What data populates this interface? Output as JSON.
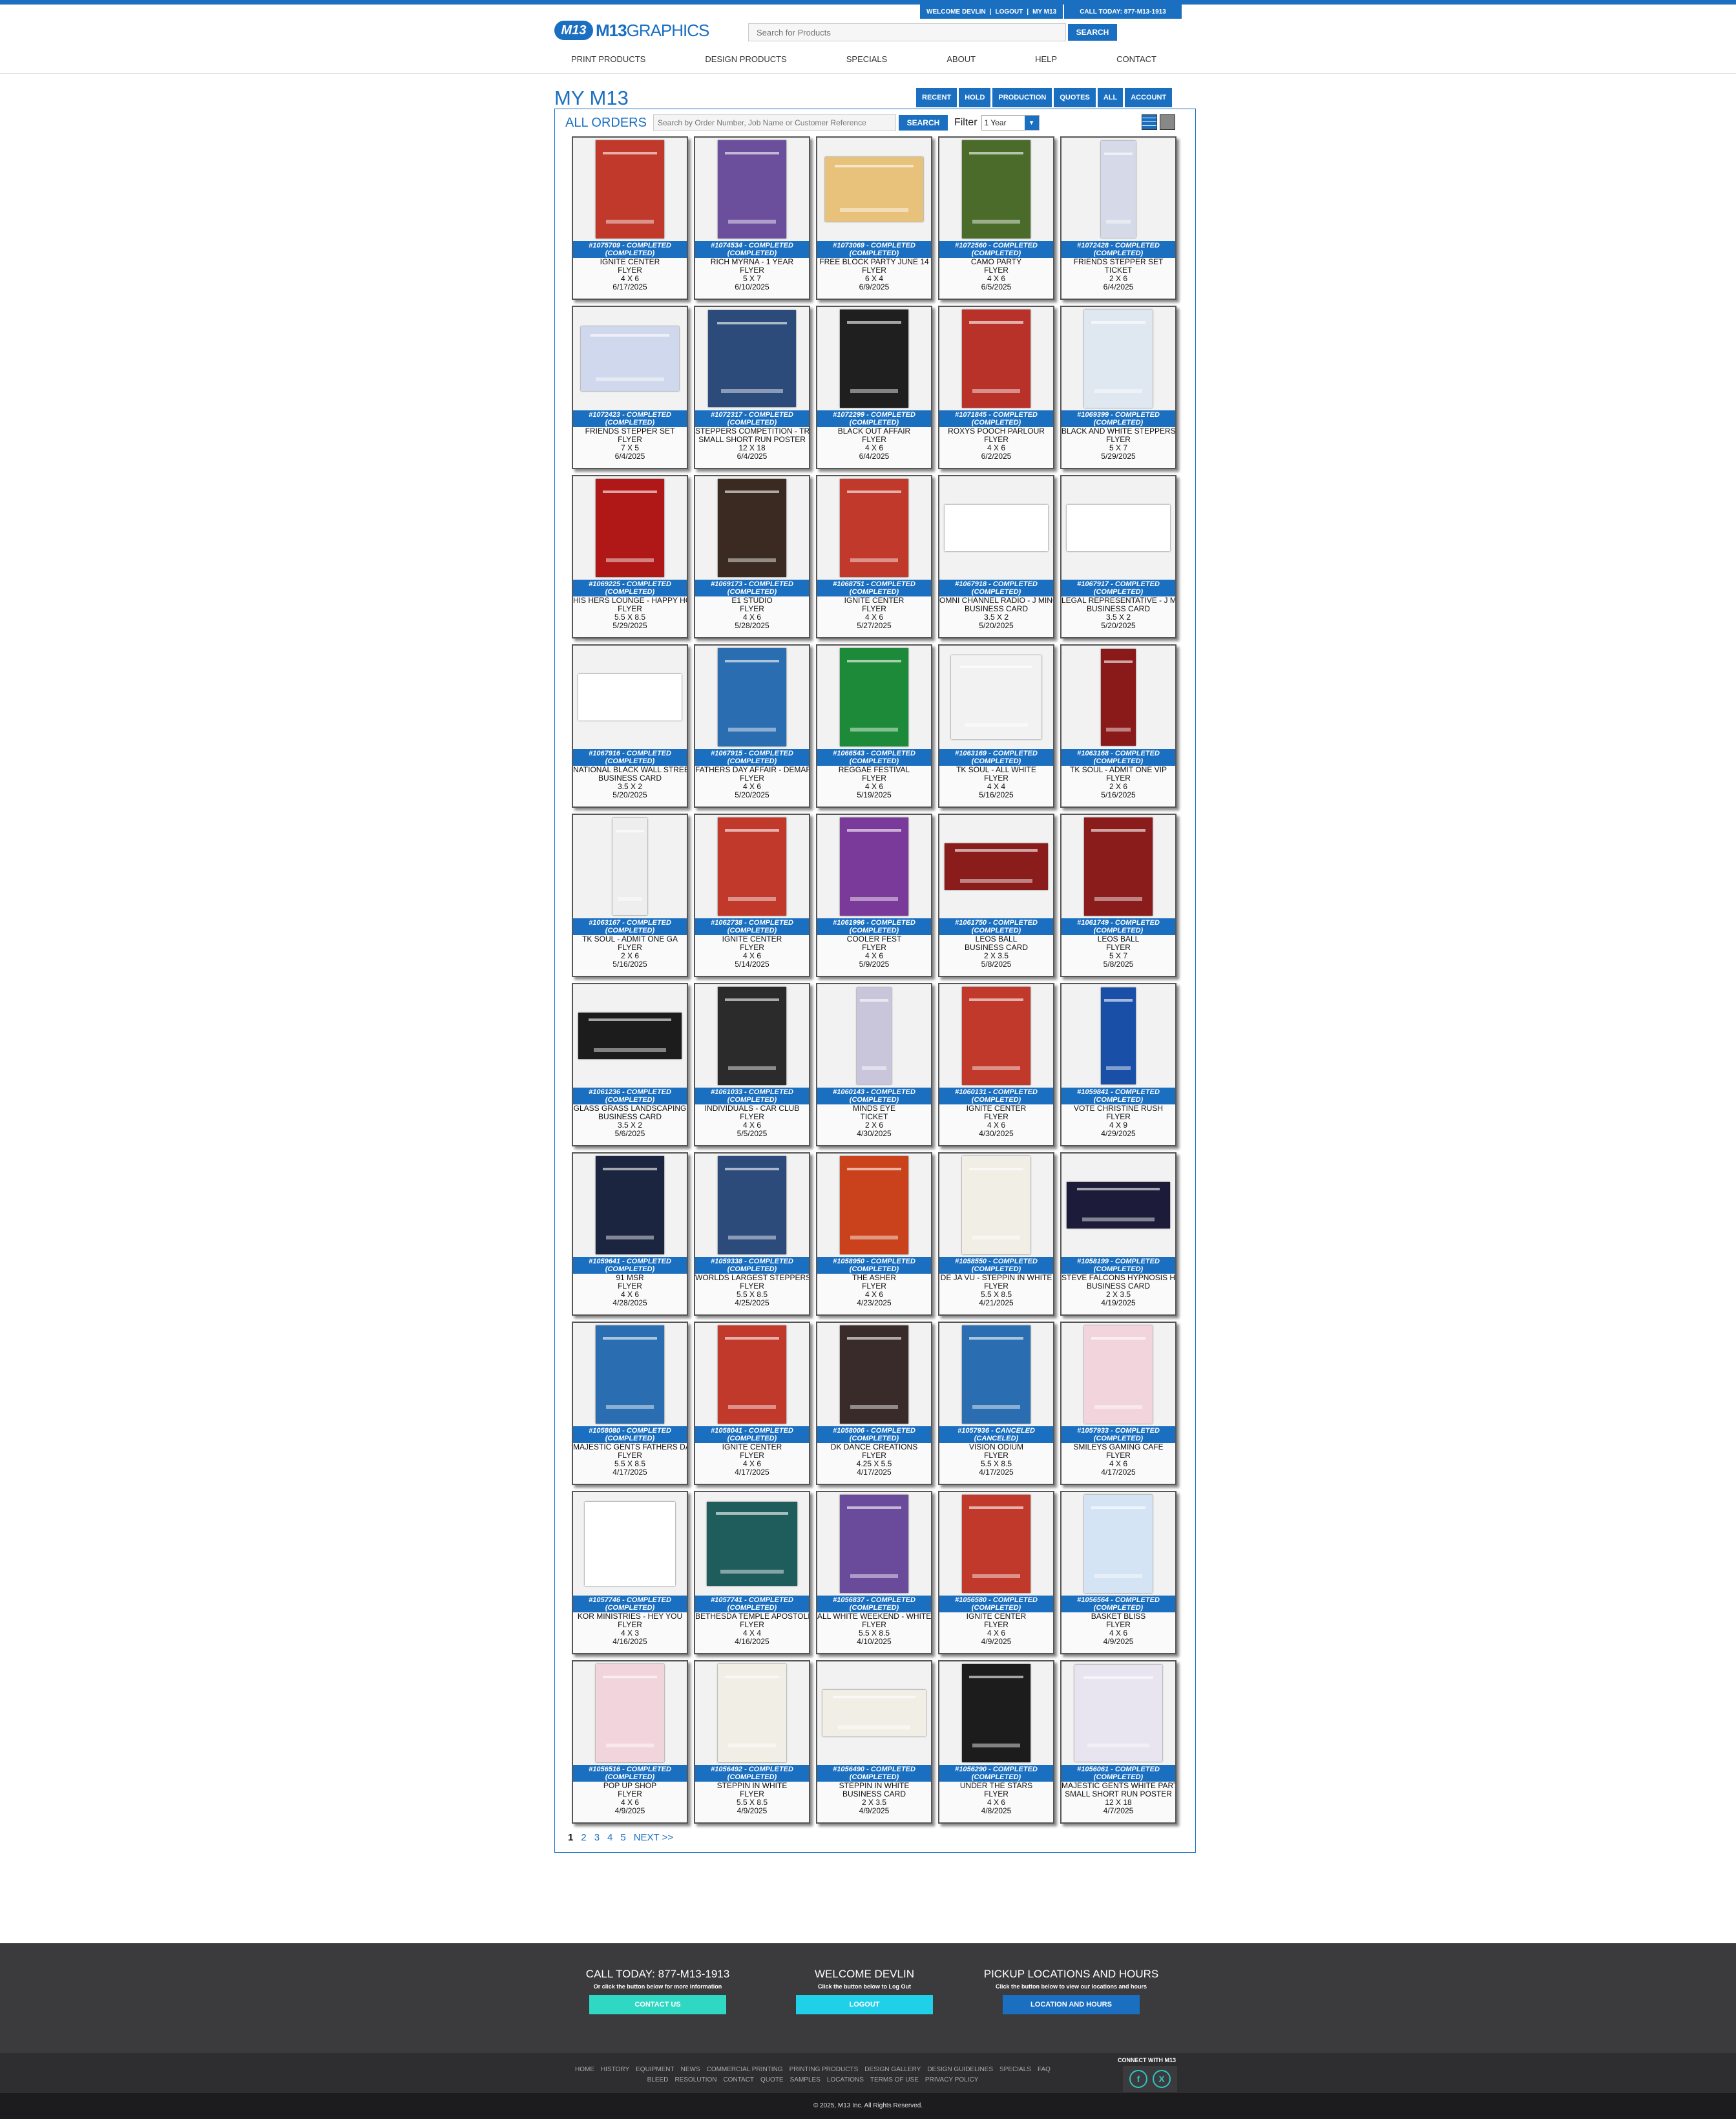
{
  "header": {
    "welcome": "WELCOME DEVLIN",
    "logout": "LOGOUT",
    "my_m13": "MY M13",
    "call": "CALL TODAY: 877-M13-1913",
    "logo_mark": "M13",
    "logo_bold": "M13",
    "logo_light": "GRAPHICS",
    "search_placeholder": "Search for Products",
    "search_button": "SEARCH"
  },
  "nav": [
    "PRINT PRODUCTS",
    "DESIGN PRODUCTS",
    "SPECIALS",
    "ABOUT",
    "HELP",
    "CONTACT"
  ],
  "page_title": "MY M13",
  "order_tabs": [
    "RECENT",
    "HOLD",
    "PRODUCTION",
    "QUOTES",
    "ALL",
    "ACCOUNT"
  ],
  "orders_panel": {
    "title": "ALL ORDERS",
    "search_placeholder": "Search by Order Number, Job Name or Customer Reference",
    "search_button": "SEARCH",
    "filter_label": "Filter",
    "filter_value": "1 Year"
  },
  "orders": [
    {
      "status": "#1075709 - COMPLETED (COMPLETED)",
      "name": "IGNITE CENTER",
      "type": "FLYER",
      "size": "4 X 6",
      "date": "6/17/2025",
      "color": "#c0392b"
    },
    {
      "status": "#1074534 - COMPLETED (COMPLETED)",
      "name": "RICH MYRNA - 1 YEAR",
      "type": "FLYER",
      "size": "5 X 7",
      "date": "6/10/2025",
      "color": "#6c4f9c"
    },
    {
      "status": "#1073069 - COMPLETED (COMPLETED)",
      "name": "FREE BLOCK PARTY JUNE 14",
      "type": "FLYER",
      "size": "6 X 4",
      "date": "6/9/2025",
      "color": "#e8c27a"
    },
    {
      "status": "#1072560 - COMPLETED (COMPLETED)",
      "name": "CAMO PARTY",
      "type": "FLYER",
      "size": "4 X 6",
      "date": "6/5/2025",
      "color": "#4a6b2a"
    },
    {
      "status": "#1072428 - COMPLETED (COMPLETED)",
      "name": "FRIENDS STEPPER SET",
      "type": "TICKET",
      "size": "2 X 6",
      "date": "6/4/2025",
      "color": "#d5d9e8"
    },
    {
      "status": "#1072423 - COMPLETED (COMPLETED)",
      "name": "FRIENDS STEPPER SET",
      "type": "FLYER",
      "size": "7 X 5",
      "date": "6/4/2025",
      "color": "#cfd8ec"
    },
    {
      "status": "#1072317 - COMPLETED (COMPLETED)",
      "name": "STEPPERS COMPETITION - TRIPLE DIAMOND",
      "type": "SMALL SHORT RUN POSTER",
      "size": "12 X 18",
      "date": "6/4/2025",
      "color": "#2c4a7a"
    },
    {
      "status": "#1072299 - COMPLETED (COMPLETED)",
      "name": "BLACK OUT AFFAIR",
      "type": "FLYER",
      "size": "4 X 6",
      "date": "6/4/2025",
      "color": "#1f1f1f"
    },
    {
      "status": "#1071845 - COMPLETED (COMPLETED)",
      "name": "ROXYS POOCH PARLOUR",
      "type": "FLYER",
      "size": "4 X 6",
      "date": "6/2/2025",
      "color": "#b8322a"
    },
    {
      "status": "#1069399 - COMPLETED (COMPLETED)",
      "name": "BLACK AND WHITE STEPPERS",
      "type": "FLYER",
      "size": "5 X 7",
      "date": "5/29/2025",
      "color": "#dfe8f0"
    },
    {
      "status": "#1069225 - COMPLETED (COMPLETED)",
      "name": "HIS HERS LOUNGE - HAPPY HOUR",
      "type": "FLYER",
      "size": "5.5 X 8.5",
      "date": "5/29/2025",
      "color": "#b01818"
    },
    {
      "status": "#1069173 - COMPLETED (COMPLETED)",
      "name": "E1 STUDIO",
      "type": "FLYER",
      "size": "4 X 6",
      "date": "5/28/2025",
      "color": "#3a2a22"
    },
    {
      "status": "#1068751 - COMPLETED (COMPLETED)",
      "name": "IGNITE CENTER",
      "type": "FLYER",
      "size": "4 X 6",
      "date": "5/27/2025",
      "color": "#c0392b"
    },
    {
      "status": "#1067918 - COMPLETED (COMPLETED)",
      "name": "OMNI CHANNEL RADIO - J MINOR",
      "type": "BUSINESS CARD",
      "size": "3.5 X 2",
      "date": "5/20/2025",
      "color": "#ffffff"
    },
    {
      "status": "#1067917 - COMPLETED (COMPLETED)",
      "name": "LEGAL REPRESENTATIVE - J MINOR",
      "type": "BUSINESS CARD",
      "size": "3.5 X 2",
      "date": "5/20/2025",
      "color": "#ffffff"
    },
    {
      "status": "#1067916 - COMPLETED (COMPLETED)",
      "name": "NATIONAL BLACK WALL STREET",
      "type": "BUSINESS CARD",
      "size": "3.5 X 2",
      "date": "5/20/2025",
      "color": "#ffffff"
    },
    {
      "status": "#1067915 - COMPLETED (COMPLETED)",
      "name": "FATHERS DAY AFFAIR - DEMARCO",
      "type": "FLYER",
      "size": "4 X 6",
      "date": "5/20/2025",
      "color": "#2a6db0"
    },
    {
      "status": "#1066543 - COMPLETED (COMPLETED)",
      "name": "REGGAE FESTIVAL",
      "type": "FLYER",
      "size": "4 X 6",
      "date": "5/19/2025",
      "color": "#1d8a3a"
    },
    {
      "status": "#1063169 - COMPLETED (COMPLETED)",
      "name": "TK SOUL - ALL WHITE",
      "type": "FLYER",
      "size": "4 X 4",
      "date": "5/16/2025",
      "color": "#f2f2f2"
    },
    {
      "status": "#1063168 - COMPLETED (COMPLETED)",
      "name": "TK SOUL - ADMIT ONE VIP",
      "type": "FLYER",
      "size": "2 X 6",
      "date": "5/16/2025",
      "color": "#8a1a1a"
    },
    {
      "status": "#1063167 - COMPLETED (COMPLETED)",
      "name": "TK SOUL - ADMIT ONE GA",
      "type": "FLYER",
      "size": "2 X 6",
      "date": "5/16/2025",
      "color": "#eeeeee"
    },
    {
      "status": "#1062738 - COMPLETED (COMPLETED)",
      "name": "IGNITE CENTER",
      "type": "FLYER",
      "size": "4 X 6",
      "date": "5/14/2025",
      "color": "#c0392b"
    },
    {
      "status": "#1061996 - COMPLETED (COMPLETED)",
      "name": "COOLER FEST",
      "type": "FLYER",
      "size": "4 X 6",
      "date": "5/9/2025",
      "color": "#7a3a9a"
    },
    {
      "status": "#1061750 - COMPLETED (COMPLETED)",
      "name": "LEOS BALL",
      "type": "BUSINESS CARD",
      "size": "2 X 3.5",
      "date": "5/8/2025",
      "color": "#8a1c1c"
    },
    {
      "status": "#1061749 - COMPLETED (COMPLETED)",
      "name": "LEOS BALL",
      "type": "FLYER",
      "size": "5 X 7",
      "date": "5/8/2025",
      "color": "#8a1c1c"
    },
    {
      "status": "#1061236 - COMPLETED (COMPLETED)",
      "name": "GLASS GRASS LANDSCAPING",
      "type": "BUSINESS CARD",
      "size": "3.5 X 2",
      "date": "5/6/2025",
      "color": "#1c1c1c"
    },
    {
      "status": "#1061033 - COMPLETED (COMPLETED)",
      "name": "INDIVIDUALS - CAR CLUB",
      "type": "FLYER",
      "size": "4 X 6",
      "date": "5/5/2025",
      "color": "#2b2b2b"
    },
    {
      "status": "#1060143 - COMPLETED (COMPLETED)",
      "name": "MINDS EYE",
      "type": "TICKET",
      "size": "2 X 6",
      "date": "4/30/2025",
      "color": "#c9c6dc"
    },
    {
      "status": "#1060131 - COMPLETED (COMPLETED)",
      "name": "IGNITE CENTER",
      "type": "FLYER",
      "size": "4 X 6",
      "date": "4/30/2025",
      "color": "#c0392b"
    },
    {
      "status": "#1059841 - COMPLETED (COMPLETED)",
      "name": "VOTE CHRISTINE RUSH",
      "type": "FLYER",
      "size": "4 X 9",
      "date": "4/29/2025",
      "color": "#1a4fa8"
    },
    {
      "status": "#1059641 - COMPLETED (COMPLETED)",
      "name": "91 MSR",
      "type": "FLYER",
      "size": "4 X 6",
      "date": "4/28/2025",
      "color": "#1b2540"
    },
    {
      "status": "#1059338 - COMPLETED (COMPLETED)",
      "name": "WORLDS LARGEST STEPPERS",
      "type": "FLYER",
      "size": "5.5 X 8.5",
      "date": "4/25/2025",
      "color": "#2c4a7a"
    },
    {
      "status": "#1058950 - COMPLETED (COMPLETED)",
      "name": "THE ASHER",
      "type": "FLYER",
      "size": "4 X 6",
      "date": "4/23/2025",
      "color": "#c9421c"
    },
    {
      "status": "#1058550 - COMPLETED (COMPLETED)",
      "name": "DE JA VU - STEPPIN IN WHITE",
      "type": "FLYER",
      "size": "5.5 X 8.5",
      "date": "4/21/2025",
      "color": "#f1eee6"
    },
    {
      "status": "#1058199 - COMPLETED (COMPLETED)",
      "name": "STEVE FALCONS HYPNOSIS HOUR",
      "type": "BUSINESS CARD",
      "size": "2 X 3.5",
      "date": "4/19/2025",
      "color": "#1c1c3a"
    },
    {
      "status": "#1058080 - COMPLETED (COMPLETED)",
      "name": "MAJESTIC GENTS FATHERS DAY",
      "type": "FLYER",
      "size": "5.5 X 8.5",
      "date": "4/17/2025",
      "color": "#2a6db0"
    },
    {
      "status": "#1058041 - COMPLETED (COMPLETED)",
      "name": "IGNITE CENTER",
      "type": "FLYER",
      "size": "4 X 6",
      "date": "4/17/2025",
      "color": "#c0392b"
    },
    {
      "status": "#1058006 - COMPLETED (COMPLETED)",
      "name": "DK DANCE CREATIONS",
      "type": "FLYER",
      "size": "4.25 X 5.5",
      "date": "4/17/2025",
      "color": "#3a2b2b"
    },
    {
      "status": "#1057936 - CANCELED (CANCELED)",
      "name": "VISION ODIUM",
      "type": "FLYER",
      "size": "5.5 X 8.5",
      "date": "4/17/2025",
      "color": "#2a6db0"
    },
    {
      "status": "#1057933 - COMPLETED (COMPLETED)",
      "name": "SMILEYS GAMING CAFE",
      "type": "FLYER",
      "size": "4 X 6",
      "date": "4/17/2025",
      "color": "#f2d4dc"
    },
    {
      "status": "#1057746 - COMPLETED (COMPLETED)",
      "name": "KOR MINISTRIES - HEY YOU",
      "type": "FLYER",
      "size": "4 X 3",
      "date": "4/16/2025",
      "color": "#ffffff"
    },
    {
      "status": "#1057741 - COMPLETED (COMPLETED)",
      "name": "BETHESDA TEMPLE APOSTOLIC",
      "type": "FLYER",
      "size": "4 X 4",
      "date": "4/16/2025",
      "color": "#1f5c5c"
    },
    {
      "status": "#1056837 - COMPLETED (COMPLETED)",
      "name": "ALL WHITE WEEKEND - WHITE",
      "type": "FLYER",
      "size": "5.5 X 8.5",
      "date": "4/10/2025",
      "color": "#6a4a9a"
    },
    {
      "status": "#1056580 - COMPLETED (COMPLETED)",
      "name": "IGNITE CENTER",
      "type": "FLYER",
      "size": "4 X 6",
      "date": "4/9/2025",
      "color": "#c0392b"
    },
    {
      "status": "#1056564 - COMPLETED (COMPLETED)",
      "name": "BASKET BLISS",
      "type": "FLYER",
      "size": "4 X 6",
      "date": "4/9/2025",
      "color": "#d4e4f4"
    },
    {
      "status": "#1056516 - COMPLETED (COMPLETED)",
      "name": "POP UP SHOP",
      "type": "FLYER",
      "size": "4 X 6",
      "date": "4/9/2025",
      "color": "#f2d4dc"
    },
    {
      "status": "#1056492 - COMPLETED (COMPLETED)",
      "name": "STEPPIN IN WHITE",
      "type": "FLYER",
      "size": "5.5 X 8.5",
      "date": "4/9/2025",
      "color": "#f1eee6"
    },
    {
      "status": "#1056490 - COMPLETED (COMPLETED)",
      "name": "STEPPIN IN WHITE",
      "type": "BUSINESS CARD",
      "size": "2 X 3.5",
      "date": "4/9/2025",
      "color": "#f1eee6"
    },
    {
      "status": "#1056290 - COMPLETED (COMPLETED)",
      "name": "UNDER THE STARS",
      "type": "FLYER",
      "size": "4 X 6",
      "date": "4/8/2025",
      "color": "#1c1c1c"
    },
    {
      "status": "#1056061 - COMPLETED (COMPLETED)",
      "name": "MAJESTIC GENTS WHITE PARTY",
      "type": "SMALL SHORT RUN POSTER",
      "size": "12 X 18",
      "date": "4/7/2025",
      "color": "#e8e4f0"
    }
  ],
  "pagination": {
    "pages": [
      "1",
      "2",
      "3",
      "4",
      "5"
    ],
    "next": "NEXT >>"
  },
  "footer": {
    "call": {
      "title": "CALL TODAY: 877-M13-1913",
      "sub": "Or click the button below for more information",
      "button": "CONTACT US",
      "color": "#2ed8c3"
    },
    "welcome": {
      "title": "WELCOME DEVLIN",
      "sub": "Click the button below to Log Out",
      "button": "LOGOUT",
      "color": "#1fd0e8"
    },
    "pickup": {
      "title": "PICKUP LOCATIONS AND HOURS",
      "sub": "Click the button below to view our locations and hours",
      "button": "LOCATION AND HOURS",
      "color": "#1a6fc1"
    },
    "links_row1": [
      "HOME",
      "HISTORY",
      "EQUIPMENT",
      "NEWS",
      "COMMERCIAL PRINTING",
      "PRINTING PRODUCTS",
      "DESIGN GALLERY",
      "DESIGN GUIDELINES",
      "SPECIALS",
      "FAQ"
    ],
    "links_row2": [
      "BLEED",
      "RESOLUTION",
      "CONTACT",
      "QUOTE",
      "SAMPLES",
      "LOCATIONS",
      "TERMS OF USE",
      "PRIVACY POLICY"
    ],
    "connect": "CONNECT WITH M13",
    "copyright": "© 2025, M13 Inc. All Rights Reserved."
  }
}
